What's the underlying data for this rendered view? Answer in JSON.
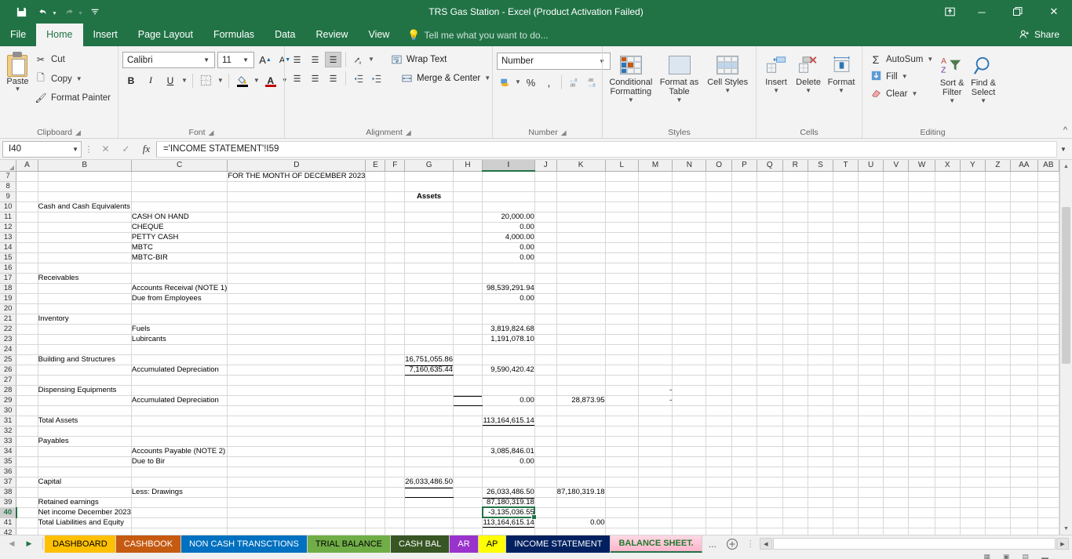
{
  "titlebar": {
    "document_title": "TRS Gas Station - Excel (Product Activation Failed)",
    "qat": [
      {
        "name": "save-icon",
        "glyph": "💾"
      },
      {
        "name": "undo-icon",
        "glyph": "↶"
      },
      {
        "name": "redo-icon",
        "glyph": "↷"
      },
      {
        "name": "customize-qat-icon",
        "glyph": "⯆"
      }
    ],
    "ribbon_display_options": "⬜",
    "minimize": "─",
    "restore": "❐",
    "close": "✕"
  },
  "menu": {
    "tabs": [
      {
        "label": "File",
        "active": false
      },
      {
        "label": "Home",
        "active": true
      },
      {
        "label": "Insert",
        "active": false
      },
      {
        "label": "Page Layout",
        "active": false
      },
      {
        "label": "Formulas",
        "active": false
      },
      {
        "label": "Data",
        "active": false
      },
      {
        "label": "Review",
        "active": false
      },
      {
        "label": "View",
        "active": false
      }
    ],
    "tellme_placeholder": "Tell me what you want to do...",
    "share_label": "Share"
  },
  "ribbon": {
    "clipboard": {
      "group_label": "Clipboard",
      "paste_label": "Paste",
      "cut_label": "Cut",
      "copy_label": "Copy",
      "format_painter_label": "Format Painter"
    },
    "font": {
      "group_label": "Font",
      "font_name": "Calibri",
      "font_size": "11",
      "grow_font": "A",
      "shrink_font": "A",
      "bold": "B",
      "italic": "I",
      "underline": "U",
      "borders": "▦",
      "fill_color": "🖌",
      "font_color": "A"
    },
    "alignment": {
      "group_label": "Alignment",
      "wrap_text_label": "Wrap Text",
      "merge_center_label": "Merge & Center",
      "orientation": "↗"
    },
    "number": {
      "group_label": "Number",
      "format_value": "Number",
      "percent": "%",
      "comma": ",",
      "increase_decimal": ".00",
      "decrease_decimal": ".00"
    },
    "styles": {
      "group_label": "Styles",
      "conditional_formatting_label": "Conditional Formatting",
      "format_as_table_label": "Format as Table",
      "cell_styles_label": "Cell Styles"
    },
    "cells": {
      "group_label": "Cells",
      "insert_label": "Insert",
      "delete_label": "Delete",
      "format_label": "Format"
    },
    "editing": {
      "group_label": "Editing",
      "autosum_label": "AutoSum",
      "fill_label": "Fill",
      "clear_label": "Clear",
      "sort_filter_label": "Sort & Filter",
      "find_select_label": "Find & Select"
    }
  },
  "formula_bar": {
    "name_box_value": "I40",
    "cancel": "✕",
    "enter": "✓",
    "insert_function": "fx",
    "formula_value": "='INCOME STATEMENT'!I59"
  },
  "grid": {
    "columns": [
      "A",
      "B",
      "C",
      "D",
      "E",
      "F",
      "G",
      "H",
      "I",
      "J",
      "K",
      "L",
      "M",
      "N",
      "O",
      "P",
      "Q",
      "R",
      "S",
      "T",
      "U",
      "V",
      "W",
      "X",
      "Y",
      "Z",
      "AA",
      "AB"
    ],
    "selected_column": "I",
    "selected_row": "40",
    "active_cell": "I40",
    "rows": [
      {
        "num": "7",
        "cells": {
          "D": "FOR THE MONTH OF DECEMBER 2023"
        }
      },
      {
        "num": "8",
        "cells": {}
      },
      {
        "num": "9",
        "cells": {
          "G": "Assets"
        }
      },
      {
        "num": "10",
        "cells": {
          "B": "Cash and Cash Equivalents"
        }
      },
      {
        "num": "11",
        "cells": {
          "C": "CASH ON HAND",
          "I": "20,000.00"
        }
      },
      {
        "num": "12",
        "cells": {
          "C": "CHEQUE",
          "I": "0.00"
        }
      },
      {
        "num": "13",
        "cells": {
          "C": "PETTY CASH",
          "I": "4,000.00"
        }
      },
      {
        "num": "14",
        "cells": {
          "C": "MBTC",
          "I": "0.00"
        }
      },
      {
        "num": "15",
        "cells": {
          "C": "MBTC-BIR",
          "I": "0.00"
        }
      },
      {
        "num": "16",
        "cells": {}
      },
      {
        "num": "17",
        "cells": {
          "B": "Receivables"
        }
      },
      {
        "num": "18",
        "cells": {
          "C": "Accounts Receival (NOTE 1)",
          "I": "98,539,291.94"
        }
      },
      {
        "num": "19",
        "cells": {
          "C": "Due from Employees",
          "I": "0.00"
        }
      },
      {
        "num": "20",
        "cells": {}
      },
      {
        "num": "21",
        "cells": {
          "B": "Inventory"
        }
      },
      {
        "num": "22",
        "cells": {
          "C": "Fuels",
          "I": "3,819,824.68"
        }
      },
      {
        "num": "23",
        "cells": {
          "C": "Lubircants",
          "I": "1,191,078.10"
        }
      },
      {
        "num": "24",
        "cells": {}
      },
      {
        "num": "25",
        "cells": {
          "B": "Building and Structures",
          "G": "16,751,055.86"
        }
      },
      {
        "num": "26",
        "cells": {
          "C": "Accumulated Depreciation",
          "G": "7,160,635.44",
          "I": "9,590,420.42"
        }
      },
      {
        "num": "27",
        "cells": {}
      },
      {
        "num": "28",
        "cells": {
          "B": "Dispensing Equipments",
          "M": "-"
        }
      },
      {
        "num": "29",
        "cells": {
          "C": "Accumulated Depreciation",
          "I": "0.00",
          "K": "28,873.95",
          "M": "-"
        }
      },
      {
        "num": "30",
        "cells": {}
      },
      {
        "num": "31",
        "cells": {
          "B": "Total Assets",
          "I": "113,164,615.14"
        }
      },
      {
        "num": "32",
        "cells": {}
      },
      {
        "num": "33",
        "cells": {
          "B": "Payables"
        }
      },
      {
        "num": "34",
        "cells": {
          "C": "Accounts Payable  (NOTE 2)",
          "I": "3,085,846.01"
        }
      },
      {
        "num": "35",
        "cells": {
          "C": "Due to Bir",
          "I": "0.00"
        }
      },
      {
        "num": "36",
        "cells": {}
      },
      {
        "num": "37",
        "cells": {
          "B": "Capital",
          "G": "26,033,486.50"
        }
      },
      {
        "num": "38",
        "cells": {
          "C": "Less: Drawings",
          "I": "26,033,486.50",
          "K": "87,180,319.18"
        }
      },
      {
        "num": "39",
        "cells": {
          "B": "Retained earnings",
          "I": "87,180,319.18"
        }
      },
      {
        "num": "40",
        "cells": {
          "B": "Net income December 2023",
          "I": "-3,135,036.55"
        }
      },
      {
        "num": "41",
        "cells": {
          "B": "Total Liabilities and Equity",
          "I": "113,164,615.14",
          "K": "0.00"
        }
      },
      {
        "num": "42",
        "cells": {}
      }
    ]
  },
  "sheet_tabs": {
    "nav": {
      "first": "◀",
      "prev": "◀",
      "next": "▶",
      "last": "▶"
    },
    "tabs": [
      {
        "label": "DASHBOARD",
        "bg": "#ffc000",
        "fg": "#000000",
        "active": false
      },
      {
        "label": "CASHBOOK",
        "bg": "#c55a11",
        "fg": "#ffffff",
        "active": false
      },
      {
        "label": "NON CASH TRANSCTIONS",
        "bg": "#0070c0",
        "fg": "#ffffff",
        "active": false
      },
      {
        "label": "TRIAL BALANCE",
        "bg": "#70ad47",
        "fg": "#000000",
        "active": false
      },
      {
        "label": "CASH BAL",
        "bg": "#375623",
        "fg": "#ffffff",
        "active": false
      },
      {
        "label": "AR",
        "bg": "#9933cc",
        "fg": "#ffffff",
        "active": false
      },
      {
        "label": "AP",
        "bg": "#ffff00",
        "fg": "#000000",
        "active": false
      },
      {
        "label": "INCOME STATEMENT",
        "bg": "#002060",
        "fg": "#ffffff",
        "active": false
      },
      {
        "label": "BALANCE SHEET.",
        "bg": "#ffb4cc",
        "fg": "#1f7a2e",
        "active": true
      }
    ],
    "overflow_label": "...",
    "add_sheet": "+"
  }
}
